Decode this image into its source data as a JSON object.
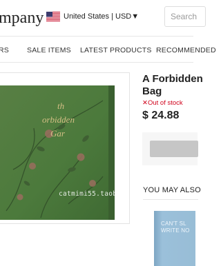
{
  "header": {
    "logo_text": "mpany",
    "region_text": "United States | USD▼",
    "flag_icon": "us-flag-icon",
    "search_placeholder": "Search"
  },
  "nav": {
    "items": [
      {
        "label": "RS"
      },
      {
        "label": "SALE ITEMS"
      },
      {
        "label": "LATEST PRODUCTS"
      },
      {
        "label": "RECOMMENDED"
      }
    ]
  },
  "product": {
    "title": "A Forbidden Bag",
    "stock_icon": "x-icon",
    "stock_text": "Out of stock",
    "price": "$ 24.88",
    "image_text": [
      "th",
      "orbidden",
      "Gar"
    ],
    "watermark": "catmimi55.taobao.com"
  },
  "related": {
    "heading": "YOU MAY ALSO",
    "book_text": [
      "CAN'T SL",
      "WRITE NO"
    ]
  },
  "colors": {
    "accent_red": "#d0021b",
    "cover_green": "#4c7a3c",
    "book_blue": "#8fb4cf"
  }
}
